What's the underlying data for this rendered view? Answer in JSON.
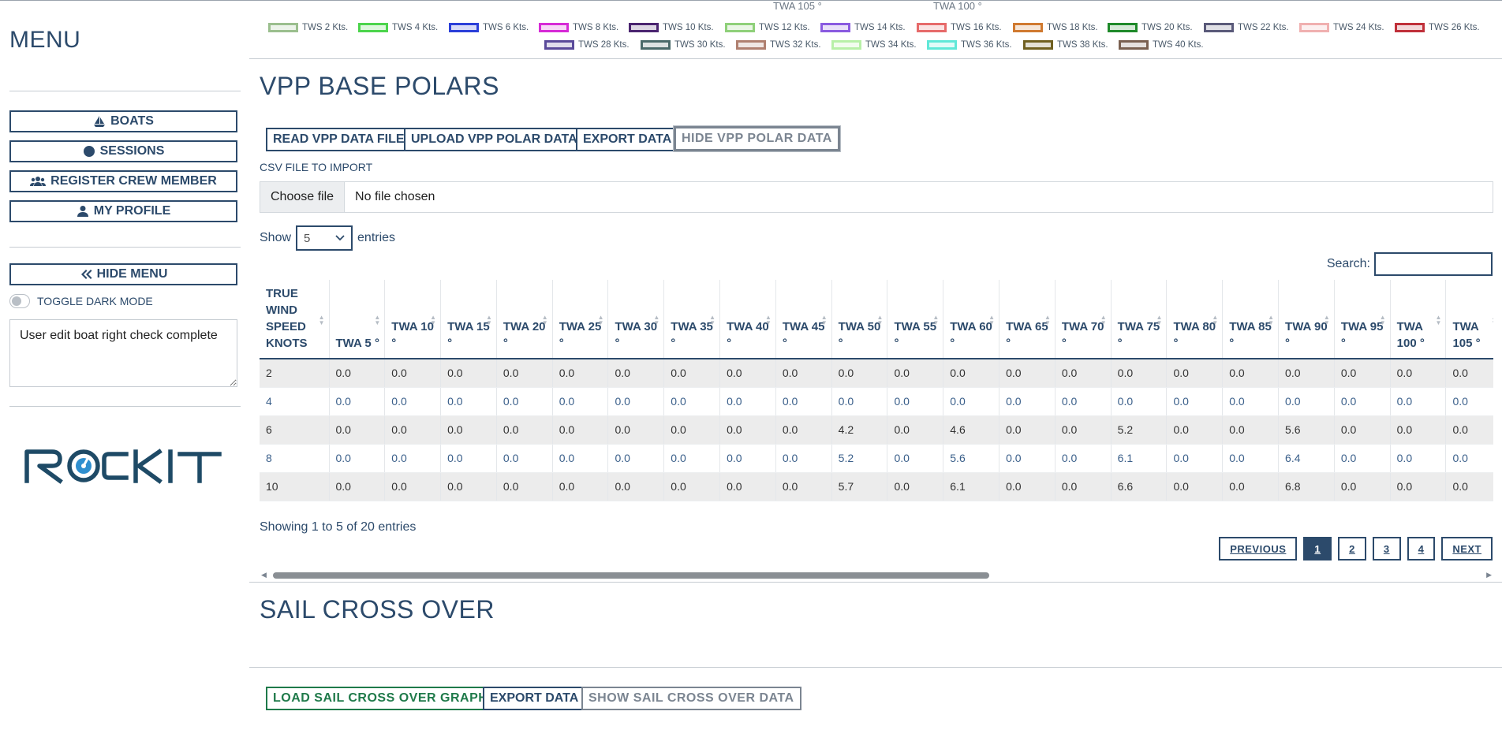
{
  "sidebar": {
    "menu_title": "MENU",
    "buttons": [
      {
        "label": "BOATS",
        "icon": "sailboat-icon"
      },
      {
        "label": "SESSIONS",
        "icon": "clock-icon"
      },
      {
        "label": "REGISTER CREW MEMBER",
        "icon": "users-icon"
      },
      {
        "label": "MY PROFILE",
        "icon": "user-icon"
      }
    ],
    "hide_menu_label": "HIDE MENU",
    "toggle_dark_label": "TOGGLE DARK MODE",
    "notes_text": "User edit boat right check complete",
    "logo_text": "ROCKIT"
  },
  "legend": {
    "ghost_labels": [
      "TWA 105 °",
      "TWA 100 °"
    ],
    "items": [
      {
        "label": "TWS 2 Kts.",
        "color": "#9bbf8e"
      },
      {
        "label": "TWS 4 Kts.",
        "color": "#4cd44c"
      },
      {
        "label": "TWS 6 Kts.",
        "color": "#2b3fd9"
      },
      {
        "label": "TWS 8 Kts.",
        "color": "#d62ad6"
      },
      {
        "label": "TWS 10 Kts.",
        "color": "#4a2470"
      },
      {
        "label": "TWS 12 Kts.",
        "color": "#8fd07a"
      },
      {
        "label": "TWS 14 Kts.",
        "color": "#8a5ae0"
      },
      {
        "label": "TWS 16 Kts.",
        "color": "#e66a6a"
      },
      {
        "label": "TWS 18 Kts.",
        "color": "#d07a30"
      },
      {
        "label": "TWS 20 Kts.",
        "color": "#1f8a2a"
      },
      {
        "label": "TWS 22 Kts.",
        "color": "#5a5a7a"
      },
      {
        "label": "TWS 24 Kts.",
        "color": "#f0b0b0"
      },
      {
        "label": "TWS 26 Kts.",
        "color": "#c0303a"
      },
      {
        "label": "TWS 28 Kts.",
        "color": "#5a4a9a"
      },
      {
        "label": "TWS 30 Kts.",
        "color": "#4a6a6a"
      },
      {
        "label": "TWS 32 Kts.",
        "color": "#b08070"
      },
      {
        "label": "TWS 34 Kts.",
        "color": "#b8f0a8"
      },
      {
        "label": "TWS 36 Kts.",
        "color": "#60e8d8"
      },
      {
        "label": "TWS 38 Kts.",
        "color": "#706020"
      },
      {
        "label": "TWS 40 Kts.",
        "color": "#7a6050"
      }
    ]
  },
  "vpp": {
    "title": "VPP BASE POLARS",
    "buttons": {
      "read": "READ VPP DATA FILE",
      "upload": "UPLOAD VPP POLAR DATA",
      "export": "EXPORT DATA",
      "hide": "HIDE VPP POLAR DATA"
    },
    "csv_label": "CSV FILE TO IMPORT",
    "choose_file": "Choose file",
    "no_file": "No file chosen",
    "show_label": "Show",
    "entries_value": "5",
    "entries_label": "entries",
    "search_label": "Search:",
    "columns": [
      "TRUE WIND SPEED KNOTS",
      "TWA 5 °",
      "TWA 10 °",
      "TWA 15 °",
      "TWA 20 °",
      "TWA 25 °",
      "TWA 30 °",
      "TWA 35 °",
      "TWA 40 °",
      "TWA 45 °",
      "TWA 50 °",
      "TWA 55 °",
      "TWA 60 °",
      "TWA 65 °",
      "TWA 70 °",
      "TWA 75 °",
      "TWA 80 °",
      "TWA 85 °",
      "TWA 90 °",
      "TWA 95 °",
      "TWA 100 °",
      "TWA 105 °"
    ],
    "rows": [
      [
        "2",
        "0.0",
        "0.0",
        "0.0",
        "0.0",
        "0.0",
        "0.0",
        "0.0",
        "0.0",
        "0.0",
        "0.0",
        "0.0",
        "0.0",
        "0.0",
        "0.0",
        "0.0",
        "0.0",
        "0.0",
        "0.0",
        "0.0",
        "0.0",
        "0.0"
      ],
      [
        "4",
        "0.0",
        "0.0",
        "0.0",
        "0.0",
        "0.0",
        "0.0",
        "0.0",
        "0.0",
        "0.0",
        "0.0",
        "0.0",
        "0.0",
        "0.0",
        "0.0",
        "0.0",
        "0.0",
        "0.0",
        "0.0",
        "0.0",
        "0.0",
        "0.0"
      ],
      [
        "6",
        "0.0",
        "0.0",
        "0.0",
        "0.0",
        "0.0",
        "0.0",
        "0.0",
        "0.0",
        "0.0",
        "4.2",
        "0.0",
        "4.6",
        "0.0",
        "0.0",
        "5.2",
        "0.0",
        "0.0",
        "5.6",
        "0.0",
        "0.0",
        "0.0"
      ],
      [
        "8",
        "0.0",
        "0.0",
        "0.0",
        "0.0",
        "0.0",
        "0.0",
        "0.0",
        "0.0",
        "0.0",
        "5.2",
        "0.0",
        "5.6",
        "0.0",
        "0.0",
        "6.1",
        "0.0",
        "0.0",
        "6.4",
        "0.0",
        "0.0",
        "0.0"
      ],
      [
        "10",
        "0.0",
        "0.0",
        "0.0",
        "0.0",
        "0.0",
        "0.0",
        "0.0",
        "0.0",
        "0.0",
        "5.7",
        "0.0",
        "6.1",
        "0.0",
        "0.0",
        "6.6",
        "0.0",
        "0.0",
        "6.8",
        "0.0",
        "0.0",
        "0.0"
      ]
    ],
    "info": "Showing 1 to 5 of 20 entries",
    "pagination": {
      "previous": "PREVIOUS",
      "pages": [
        "1",
        "2",
        "3",
        "4"
      ],
      "next": "NEXT",
      "current": "1"
    }
  },
  "sail": {
    "title": "SAIL CROSS OVER",
    "buttons": {
      "load": "LOAD SAIL CROSS OVER GRAPHS",
      "export": "EXPORT DATA",
      "show": "SHOW SAIL CROSS OVER DATA"
    }
  },
  "colors": {
    "primary": "#2c4a6b",
    "green": "#1f7a4a",
    "muted": "#7b8591",
    "row_stripe": "#ececec"
  }
}
